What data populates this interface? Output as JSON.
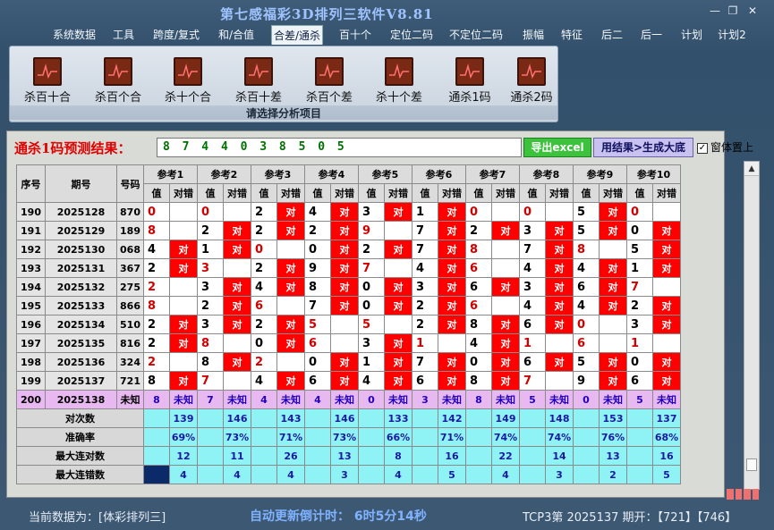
{
  "window": {
    "title": "第七感福彩3D排列三软件V8.81"
  },
  "menu": [
    "系统数据",
    "工具",
    "跨度/复式",
    "和/合值",
    "合差/通杀",
    "百十个",
    "定位二码",
    "不定位二码",
    "振幅",
    "特征",
    "后二",
    "后一",
    "计划",
    "计划2"
  ],
  "menu_active": 4,
  "ribbon": {
    "buttons": [
      "杀百十合",
      "杀百个合",
      "杀十个合",
      "杀百十差",
      "杀百个差",
      "杀十个差",
      "通杀1码",
      "通杀2码"
    ],
    "caption": "请选择分析项目"
  },
  "prediction": {
    "label": "通杀1码预测结果：",
    "digits": "8 7 4 4 0 3 8 5 0 5",
    "excel_button": "导出excel",
    "generate_button": "用结果>生成大底",
    "pin_label": "窗体置上",
    "pin_checked": true
  },
  "table": {
    "headers": {
      "seq": "序号",
      "issue": "期号",
      "num": "号码"
    },
    "ref_labels": [
      "参考1",
      "参考2",
      "参考3",
      "参考4",
      "参考5",
      "参考6",
      "参考7",
      "参考8",
      "参考9",
      "参考10"
    ],
    "sub_val": "值",
    "sub_ok": "对错",
    "hit_text": "对",
    "rows": [
      {
        "seq": "190",
        "issue": "2025128",
        "num": "870",
        "refs": [
          [
            "0",
            ""
          ],
          [
            "0",
            ""
          ],
          [
            "2",
            "对"
          ],
          [
            "4",
            "对"
          ],
          [
            "3",
            "对"
          ],
          [
            "1",
            "对"
          ],
          [
            "0",
            ""
          ],
          [
            "0",
            ""
          ],
          [
            "5",
            "对"
          ],
          [
            "0",
            ""
          ]
        ]
      },
      {
        "seq": "191",
        "issue": "2025129",
        "num": "189",
        "refs": [
          [
            "8",
            ""
          ],
          [
            "2",
            "对"
          ],
          [
            "2",
            "对"
          ],
          [
            "2",
            "对"
          ],
          [
            "9",
            ""
          ],
          [
            "7",
            "对"
          ],
          [
            "2",
            "对"
          ],
          [
            "3",
            "对"
          ],
          [
            "5",
            "对"
          ],
          [
            "0",
            "对"
          ]
        ]
      },
      {
        "seq": "192",
        "issue": "2025130",
        "num": "068",
        "refs": [
          [
            "4",
            "对"
          ],
          [
            "1",
            "对"
          ],
          [
            "0",
            ""
          ],
          [
            "0",
            "对"
          ],
          [
            "2",
            "对"
          ],
          [
            "7",
            "对"
          ],
          [
            "8",
            ""
          ],
          [
            "7",
            "对"
          ],
          [
            "8",
            ""
          ],
          [
            "5",
            "对"
          ]
        ]
      },
      {
        "seq": "193",
        "issue": "2025131",
        "num": "367",
        "refs": [
          [
            "2",
            "对"
          ],
          [
            "3",
            ""
          ],
          [
            "2",
            "对"
          ],
          [
            "9",
            "对"
          ],
          [
            "7",
            ""
          ],
          [
            "4",
            "对"
          ],
          [
            "6",
            ""
          ],
          [
            "4",
            "对"
          ],
          [
            "4",
            "对"
          ],
          [
            "1",
            "对"
          ]
        ]
      },
      {
        "seq": "194",
        "issue": "2025132",
        "num": "275",
        "refs": [
          [
            "2",
            ""
          ],
          [
            "3",
            "对"
          ],
          [
            "4",
            "对"
          ],
          [
            "8",
            "对"
          ],
          [
            "0",
            "对"
          ],
          [
            "3",
            "对"
          ],
          [
            "6",
            "对"
          ],
          [
            "3",
            "对"
          ],
          [
            "6",
            "对"
          ],
          [
            "7",
            ""
          ]
        ]
      },
      {
        "seq": "195",
        "issue": "2025133",
        "num": "866",
        "refs": [
          [
            "8",
            ""
          ],
          [
            "2",
            "对"
          ],
          [
            "6",
            ""
          ],
          [
            "7",
            "对"
          ],
          [
            "0",
            "对"
          ],
          [
            "2",
            "对"
          ],
          [
            "6",
            ""
          ],
          [
            "4",
            "对"
          ],
          [
            "4",
            "对"
          ],
          [
            "2",
            "对"
          ]
        ]
      },
      {
        "seq": "196",
        "issue": "2025134",
        "num": "510",
        "refs": [
          [
            "2",
            "对"
          ],
          [
            "3",
            "对"
          ],
          [
            "2",
            "对"
          ],
          [
            "5",
            ""
          ],
          [
            "5",
            ""
          ],
          [
            "2",
            "对"
          ],
          [
            "8",
            "对"
          ],
          [
            "6",
            "对"
          ],
          [
            "0",
            ""
          ],
          [
            "3",
            "对"
          ]
        ]
      },
      {
        "seq": "197",
        "issue": "2025135",
        "num": "816",
        "refs": [
          [
            "2",
            "对"
          ],
          [
            "8",
            ""
          ],
          [
            "0",
            "对"
          ],
          [
            "6",
            ""
          ],
          [
            "3",
            "对"
          ],
          [
            "1",
            ""
          ],
          [
            "4",
            "对"
          ],
          [
            "1",
            ""
          ],
          [
            "6",
            ""
          ],
          [
            "1",
            ""
          ]
        ]
      },
      {
        "seq": "198",
        "issue": "2025136",
        "num": "324",
        "refs": [
          [
            "2",
            ""
          ],
          [
            "8",
            "对"
          ],
          [
            "2",
            ""
          ],
          [
            "0",
            "对"
          ],
          [
            "1",
            "对"
          ],
          [
            "7",
            "对"
          ],
          [
            "0",
            "对"
          ],
          [
            "6",
            "对"
          ],
          [
            "5",
            "对"
          ],
          [
            "0",
            "对"
          ]
        ]
      },
      {
        "seq": "199",
        "issue": "2025137",
        "num": "721",
        "refs": [
          [
            "8",
            "对"
          ],
          [
            "7",
            ""
          ],
          [
            "4",
            "对"
          ],
          [
            "6",
            "对"
          ],
          [
            "4",
            "对"
          ],
          [
            "6",
            "对"
          ],
          [
            "8",
            "对"
          ],
          [
            "7",
            ""
          ],
          [
            "9",
            "对"
          ],
          [
            "6",
            "对"
          ]
        ]
      }
    ],
    "last_row": {
      "seq": "200",
      "issue": "2025138",
      "num": "未知",
      "refs": [
        "8",
        "7",
        "4",
        "4",
        "0",
        "3",
        "8",
        "5",
        "0",
        "5"
      ],
      "unknown": "未知"
    },
    "stats": [
      {
        "label": "对次数",
        "values": [
          "139",
          "146",
          "143",
          "146",
          "133",
          "142",
          "149",
          "148",
          "153",
          "137"
        ]
      },
      {
        "label": "准确率",
        "values": [
          "69%",
          "73%",
          "71%",
          "73%",
          "66%",
          "71%",
          "74%",
          "74%",
          "76%",
          "68%"
        ]
      },
      {
        "label": "最大连对数",
        "values": [
          "12",
          "11",
          "26",
          "13",
          "8",
          "16",
          "22",
          "14",
          "13",
          "16"
        ]
      },
      {
        "label": "最大连错数",
        "values": [
          "4",
          "4",
          "4",
          "3",
          "4",
          "5",
          "4",
          "3",
          "2",
          "5"
        ]
      }
    ]
  },
  "status": {
    "current_data": "当前数据为：[体彩排列三]",
    "countdown": "自动更新倒计时：  6时5分14秒",
    "draw": "TCP3第 2025137 期开：【721】【746】"
  },
  "colors": {
    "hit": "#ff0000",
    "stat": "#8ff3f6",
    "last_row": "#e8b8f0",
    "prediction": "#007000"
  }
}
